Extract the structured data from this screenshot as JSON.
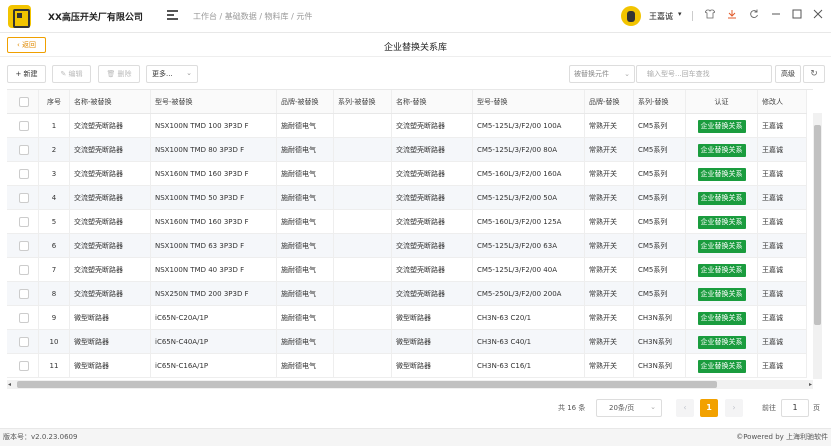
{
  "app": {
    "company": "XX高压开关厂有限公司",
    "breadcrumb": "工作台 / 基础数据 / 物料库 / 元件",
    "username": "王嘉诚",
    "user_chevron": "▾",
    "window_icons": [
      "shirt-icon",
      "download-icon",
      "refresh-icon",
      "minimize-icon",
      "maximize-icon",
      "close-icon"
    ]
  },
  "tabbar": {
    "back_label": "‹ 返回",
    "page_title": "企业替换关系库"
  },
  "toolbar": {
    "new_label": "+ 新建",
    "edit_label": "✎ 编辑",
    "delete_label": "🗑 删除",
    "more_label": "更多...",
    "more_chevron": "⌄",
    "filter_select": "被替换元件",
    "filter_chevron": "⌄",
    "search_placeholder": "输入型号...回车查找",
    "advanced_label": "高级",
    "refresh_label": "↻"
  },
  "table": {
    "columns": [
      "序号",
      "名称-被替换",
      "型号-被替换",
      "品牌-被替换",
      "系列-被替换",
      "名称-替换",
      "型号-替换",
      "品牌-替换",
      "系列-替换",
      "认证",
      "修改人"
    ],
    "rows": [
      [
        "1",
        "交流塑壳断路器",
        "NSX100N TMD 100 3P3D F",
        "施耐德电气",
        "",
        "交流塑壳断路器",
        "CM5-125L/3/F2/00 100A",
        "常熟开关",
        "CM5系列",
        "企业替换关系",
        "王嘉诚"
      ],
      [
        "2",
        "交流塑壳断路器",
        "NSX100N TMD 80 3P3D F",
        "施耐德电气",
        "",
        "交流塑壳断路器",
        "CM5-125L/3/F2/00 80A",
        "常熟开关",
        "CM5系列",
        "企业替换关系",
        "王嘉诚"
      ],
      [
        "3",
        "交流塑壳断路器",
        "NSX160N TMD 160 3P3D F",
        "施耐德电气",
        "",
        "交流塑壳断路器",
        "CM5-160L/3/F2/00 160A",
        "常熟开关",
        "CM5系列",
        "企业替换关系",
        "王嘉诚"
      ],
      [
        "4",
        "交流塑壳断路器",
        "NSX100N TMD 50 3P3D F",
        "施耐德电气",
        "",
        "交流塑壳断路器",
        "CM5-125L/3/F2/00 50A",
        "常熟开关",
        "CM5系列",
        "企业替换关系",
        "王嘉诚"
      ],
      [
        "5",
        "交流塑壳断路器",
        "NSX160N TMD 160 3P3D F",
        "施耐德电气",
        "",
        "交流塑壳断路器",
        "CM5-160L/3/F2/00 125A",
        "常熟开关",
        "CM5系列",
        "企业替换关系",
        "王嘉诚"
      ],
      [
        "6",
        "交流塑壳断路器",
        "NSX100N TMD 63 3P3D F",
        "施耐德电气",
        "",
        "交流塑壳断路器",
        "CM5-125L/3/F2/00 63A",
        "常熟开关",
        "CM5系列",
        "企业替换关系",
        "王嘉诚"
      ],
      [
        "7",
        "交流塑壳断路器",
        "NSX100N TMD 40 3P3D F",
        "施耐德电气",
        "",
        "交流塑壳断路器",
        "CM5-125L/3/F2/00 40A",
        "常熟开关",
        "CM5系列",
        "企业替换关系",
        "王嘉诚"
      ],
      [
        "8",
        "交流塑壳断路器",
        "NSX250N TMD 200 3P3D F",
        "施耐德电气",
        "",
        "交流塑壳断路器",
        "CM5-250L/3/F2/00 200A",
        "常熟开关",
        "CM5系列",
        "企业替换关系",
        "王嘉诚"
      ],
      [
        "9",
        "微型断路器",
        "iC65N-C20A/1P",
        "施耐德电气",
        "",
        "微型断路器",
        "CH3N-63 C20/1",
        "常熟开关",
        "CH3N系列",
        "企业替换关系",
        "王嘉诚"
      ],
      [
        "10",
        "微型断路器",
        "iC65N-C40A/1P",
        "施耐德电气",
        "",
        "微型断路器",
        "CH3N-63 C40/1",
        "常熟开关",
        "CH3N系列",
        "企业替换关系",
        "王嘉诚"
      ],
      [
        "11",
        "微型断路器",
        "iC65N-C16A/1P",
        "施耐德电气",
        "",
        "微型断路器",
        "CH3N-63 C16/1",
        "常熟开关",
        "CH3N系列",
        "企业替换关系",
        "王嘉诚"
      ]
    ]
  },
  "pagination": {
    "total": "共 16 条",
    "page_size": "20条/页",
    "page_size_chevron": "⌄",
    "prev": "‹",
    "current": "1",
    "next": "›",
    "goto_label": "前往",
    "goto_value": "1",
    "goto_unit": "页"
  },
  "scroll": {
    "left": "◂",
    "right": "▸"
  },
  "footer": {
    "version": "版本号：v2.0.23.0609",
    "powered": "©Powered by 上海利驰软件"
  },
  "colors": {
    "accent": "#f2a100",
    "badge": "#1a9c3e",
    "logo": "#f2c400"
  }
}
